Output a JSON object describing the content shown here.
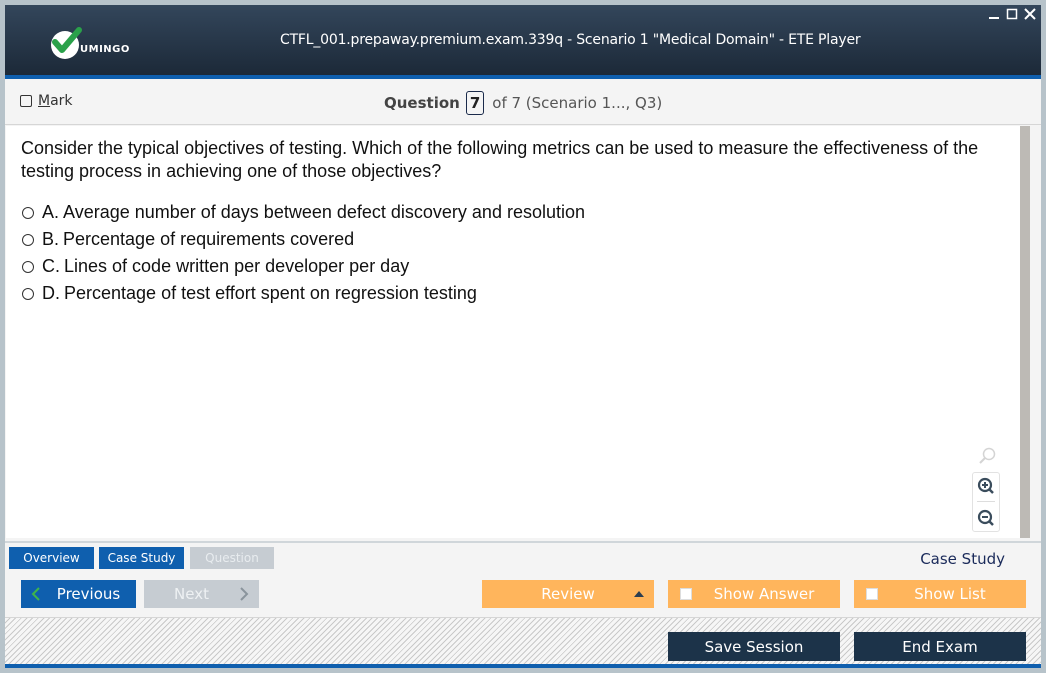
{
  "window": {
    "logo_text": "UMINGO",
    "title": "CTFL_001.prepaway.premium.exam.339q - Scenario 1 \"Medical Domain\" - ETE Player",
    "controls": [
      "minimize-icon",
      "maximize-icon",
      "close-icon"
    ]
  },
  "header": {
    "mark_prefix": "",
    "mark_underlined": "M",
    "mark_rest": "ark",
    "question_label": "Question",
    "question_number": "7",
    "question_of": "of 7 (Scenario 1..., Q3)"
  },
  "question": {
    "text": "Consider the typical objectives of testing. Which of the following metrics can be used to measure the effectiveness of the testing process in achieving one of those objectives?",
    "options": [
      {
        "letter": "A.",
        "text": "Average number of days between defect discovery and resolution"
      },
      {
        "letter": "B.",
        "text": "Percentage of requirements covered"
      },
      {
        "letter": "C.",
        "text": "Lines of code written per developer per day"
      },
      {
        "letter": "D.",
        "text": "Percentage of test effort spent on regression testing"
      }
    ]
  },
  "zoom_tools": [
    "find-icon",
    "zoom-in-icon",
    "zoom-out-icon"
  ],
  "tabs": [
    {
      "label": "Overview",
      "state": "active"
    },
    {
      "label": "Case Study",
      "state": "active"
    },
    {
      "label": "Question",
      "state": "disabled"
    }
  ],
  "tabbar_label": "Case Study",
  "nav": {
    "previous": "Previous",
    "next": "Next",
    "review": "Review",
    "show_answer": "Show Answer",
    "show_list": "Show List"
  },
  "footer": {
    "save_session": "Save Session",
    "end_exam": "End Exam"
  },
  "colors": {
    "accent_blue": "#0f5fae",
    "orange": "#ffb55c",
    "navy": "#1c3349",
    "disabled": "#c6ccd2"
  }
}
